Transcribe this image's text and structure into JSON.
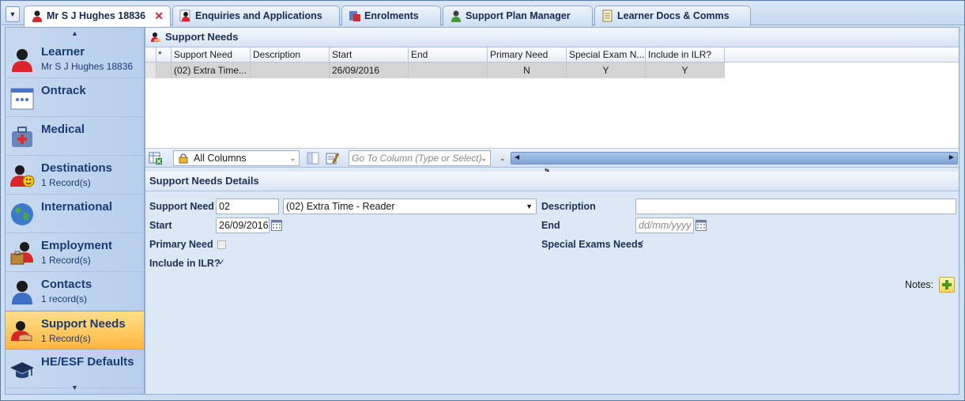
{
  "tabs": [
    {
      "label": "Mr S J Hughes 18836",
      "active": true,
      "closable": true,
      "icon": "person-icon"
    },
    {
      "label": "Enquiries and Applications",
      "icon": "person-doc-icon"
    },
    {
      "label": "Enrolments",
      "icon": "enrolments-icon"
    },
    {
      "label": "Support Plan Manager",
      "icon": "support-plan-icon"
    },
    {
      "label": "Learner Docs & Comms",
      "icon": "docs-icon"
    }
  ],
  "sidebar": {
    "items": [
      {
        "title": "Learner",
        "sub": "Mr S J Hughes 18836",
        "icon": "learner-icon"
      },
      {
        "title": "Ontrack",
        "sub": "",
        "icon": "ontrack-icon"
      },
      {
        "title": "Medical",
        "sub": "",
        "icon": "medical-icon"
      },
      {
        "title": "Destinations",
        "sub": "1 Record(s)",
        "icon": "destinations-icon"
      },
      {
        "title": "International",
        "sub": "",
        "icon": "globe-icon"
      },
      {
        "title": "Employment",
        "sub": "1 Record(s)",
        "icon": "employment-icon"
      },
      {
        "title": "Contacts",
        "sub": "1 record(s)",
        "icon": "contacts-icon"
      },
      {
        "title": "Support Needs",
        "sub": "1 Record(s)",
        "icon": "support-needs-icon",
        "active": true
      },
      {
        "title": "HE/ESF Defaults",
        "sub": "",
        "icon": "graduation-cap-icon"
      }
    ]
  },
  "grid": {
    "title": "Support Needs",
    "indicator": "*",
    "columns": [
      "Support Need",
      "Description",
      "Start",
      "End",
      "Primary Need",
      "Special Exam N...",
      "Include in ILR?"
    ],
    "rows": [
      [
        "(02) Extra Time...",
        "",
        "26/09/2016",
        "",
        "N",
        "Y",
        "Y"
      ]
    ]
  },
  "toolbar": {
    "column_filter": "All Columns",
    "goto_placeholder": "Go To Column (Type or Select)"
  },
  "details": {
    "title": "Support Needs Details",
    "support_need_label": "Support Need",
    "support_need_code": "02",
    "support_need_value": "(02) Extra Time - Reader",
    "description_label": "Description",
    "description_value": "",
    "start_label": "Start",
    "start_value": "26/09/2016",
    "end_label": "End",
    "end_placeholder": "dd/mm/yyyy",
    "primary_need_label": "Primary Need",
    "primary_need_checked": false,
    "special_exams_label": "Special Exams Needs",
    "special_exams_checked": true,
    "include_ilr_label": "Include in ILR?",
    "include_ilr_checked": true,
    "notes_label": "Notes:",
    "check_mark": "✓"
  },
  "colors": {
    "accent": "#1b3a73",
    "active_nav": "#ffb640",
    "panel": "#dde8f6"
  }
}
